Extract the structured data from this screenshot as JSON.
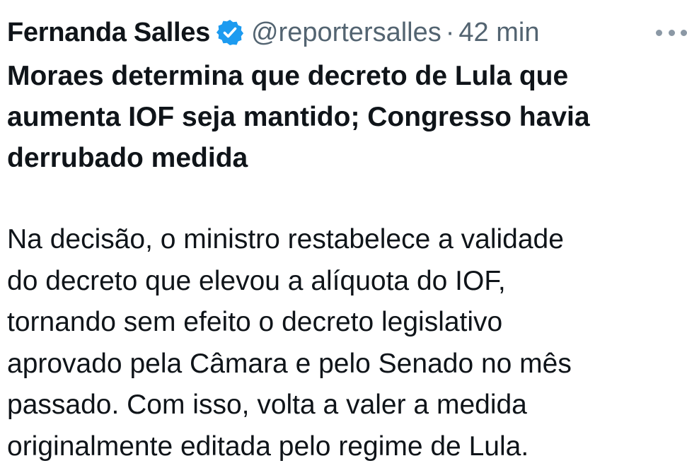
{
  "tweet": {
    "author": {
      "display_name": "Fernanda Salles",
      "handle": "@reportersalles",
      "verified_icon": "verified-badge-icon",
      "verified_color": "#1d9bf0"
    },
    "separator": "·",
    "time": "42 min",
    "more_icon": "more-options-icon",
    "headline_lines": [
      "Moraes determina que decreto de Lula que",
      "aumenta IOF seja mantido; Congresso havia",
      "derrubado medida"
    ],
    "body_lines": [
      "Na decisão, o ministro restabelece a validade",
      "do decreto que elevou a alíquota do IOF,",
      "tornando sem efeito o decreto legislativo",
      "aprovado pela Câmara e pelo Senado no mês",
      "passado. Com isso, volta a valer a medida",
      "originalmente editada pelo regime de Lula."
    ]
  }
}
